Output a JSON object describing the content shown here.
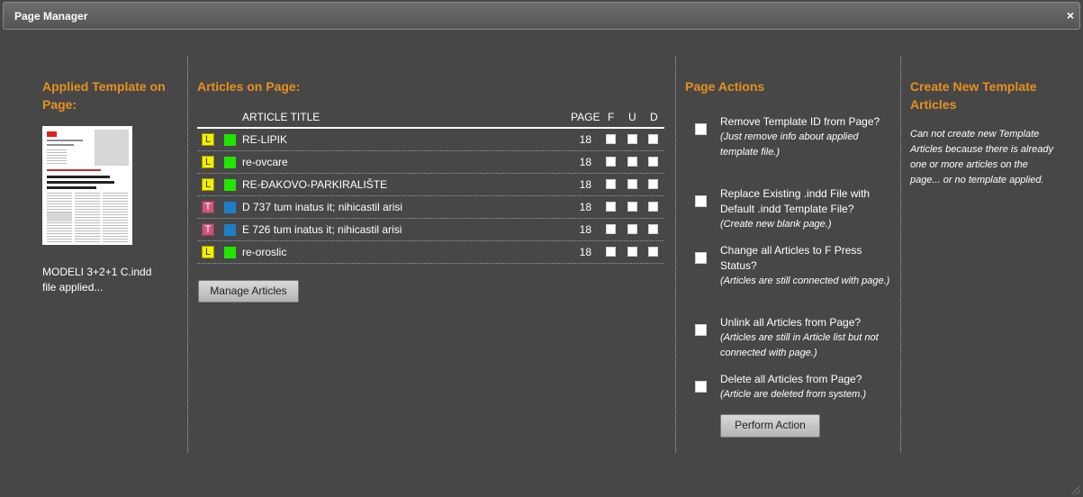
{
  "window": {
    "title": "Page Manager",
    "close_icon": "×"
  },
  "template": {
    "heading": "Applied Template on Page:",
    "applied_text": "MODELI 3+2+1 C.indd file applied..."
  },
  "articles": {
    "heading": "Articles on Page:",
    "columns": {
      "title": "ARTICLE TITLE",
      "page": "PAGE",
      "f": "F",
      "u": "U",
      "d": "D"
    },
    "rows": [
      {
        "type": "L",
        "type_color": "#f5f000",
        "status_color": "#22e600",
        "title": "RE-LIPIK",
        "page": "18"
      },
      {
        "type": "L",
        "type_color": "#f5f000",
        "status_color": "#22e600",
        "title": "re-ovcare",
        "page": "18"
      },
      {
        "type": "L",
        "type_color": "#f5f000",
        "status_color": "#22e600",
        "title": "RE-ĐAKOVO-PARKIRALIŠTE",
        "page": "18"
      },
      {
        "type": "T",
        "type_color": "#c8567e",
        "status_color": "#1f7fc8",
        "title": "D 737 tum inatus it; nihicastil arisi",
        "page": "18"
      },
      {
        "type": "T",
        "type_color": "#c8567e",
        "status_color": "#1f7fc8",
        "title": "E 726 tum inatus it; nihicastil arisi",
        "page": "18"
      },
      {
        "type": "L",
        "type_color": "#f5f000",
        "status_color": "#22e600",
        "title": "re-oroslic",
        "page": "18"
      }
    ],
    "manage_button": "Manage Articles"
  },
  "actions": {
    "heading": "Page Actions",
    "items": [
      {
        "label": "Remove Template ID from Page?",
        "note": "(Just remove info about applied template file.)"
      },
      {
        "label": "Replace Existing .indd File with Default .indd Template File?",
        "note": "(Create new blank page.)"
      },
      {
        "label": "Change all Articles to F Press Status?",
        "note": "(Articles are still connected with page.)"
      },
      {
        "label": "Unlink all Articles from Page?",
        "note": "(Articles are still in Article list but not connected with page.)"
      },
      {
        "label": "Delete all Articles from Page?",
        "note": "(Article are deleted from system.)"
      }
    ],
    "perform_button": "Perform Action"
  },
  "create": {
    "heading": "Create New Template Articles",
    "note": "Can not create new Template Articles because there is already one or more articles on the page... or no template applied."
  },
  "colors": {
    "accent": "#e8901c",
    "background": "#474747"
  }
}
